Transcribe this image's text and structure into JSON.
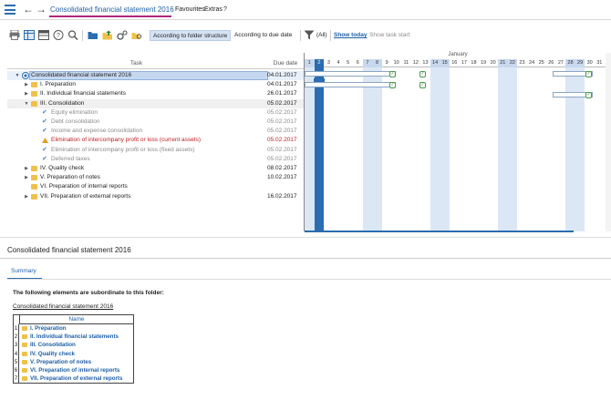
{
  "app": {
    "title": "Consolidated financial statement 2016",
    "menu": [
      "Favourites",
      "Extras",
      "?"
    ]
  },
  "toolbar": {
    "view_modes": [
      {
        "label": "According to folder structure",
        "active": true
      },
      {
        "label": "According to due date",
        "active": false
      }
    ],
    "filter_label": "(All)",
    "show_today_label": "Show today",
    "show_task_start_label": "Show task start"
  },
  "tree": {
    "col_task": "Task",
    "col_due": "Due date",
    "rows": [
      {
        "label": "Consolidated financial statement 2016",
        "due": "04.01.2017",
        "level": 0,
        "expand": "▼",
        "icon": "consolidation-root-icon",
        "style": "selected"
      },
      {
        "label": "I. Preparation",
        "due": "04.01.2017",
        "level": 1,
        "expand": "▶",
        "icon": "folder-icon",
        "style": "normal"
      },
      {
        "label": "II. Individual financial statements",
        "due": "26.01.2017",
        "level": 1,
        "expand": "▶",
        "icon": "folder-icon",
        "style": "normal"
      },
      {
        "label": "III. Consolidation",
        "due": "05.02.2017",
        "level": 1,
        "expand": "▼",
        "icon": "folder-icon",
        "style": "hover"
      },
      {
        "label": "Equity elimination",
        "due": "05.02.2017",
        "level": 2,
        "expand": "",
        "icon": "task-check-icon",
        "style": "done"
      },
      {
        "label": "Debt consolidation",
        "due": "05.02.2017",
        "level": 2,
        "expand": "",
        "icon": "task-check-icon",
        "style": "done"
      },
      {
        "label": "Income and expense consolidation",
        "due": "05.02.2017",
        "level": 2,
        "expand": "",
        "icon": "task-check-icon",
        "style": "done"
      },
      {
        "label": "Elimination of intercompany profit or loss (current assets)",
        "due": "05.02.2017",
        "level": 2,
        "expand": "",
        "icon": "warning-icon",
        "style": "warning"
      },
      {
        "label": "Elimination of intercompany profit or loss (fixed assets)",
        "due": "05.02.2017",
        "level": 2,
        "expand": "",
        "icon": "task-check-icon",
        "style": "done"
      },
      {
        "label": "Deferred taxes",
        "due": "05.02.2017",
        "level": 2,
        "expand": "",
        "icon": "task-check-icon",
        "style": "done"
      },
      {
        "label": "IV. Quality check",
        "due": "08.02.2017",
        "level": 1,
        "expand": "▶",
        "icon": "folder-icon",
        "style": "normal"
      },
      {
        "label": "V. Preparation of notes",
        "due": "10.02.2017",
        "level": 1,
        "expand": "▶",
        "icon": "folder-icon",
        "style": "normal"
      },
      {
        "label": "VI. Preparation of internal reports",
        "due": "",
        "level": 1,
        "expand": "",
        "icon": "folder-icon",
        "style": "normal"
      },
      {
        "label": "VII. Preparation of external reports",
        "due": "16.02.2017",
        "level": 1,
        "expand": "▶",
        "icon": "folder-icon",
        "style": "normal"
      }
    ]
  },
  "gantt": {
    "month": "January",
    "days": [
      "1",
      "2",
      "3",
      "4",
      "5",
      "6",
      "7",
      "8",
      "9",
      "10",
      "11",
      "12",
      "13",
      "14",
      "15",
      "16",
      "17",
      "18",
      "19",
      "20",
      "21",
      "22",
      "23",
      "24",
      "25",
      "26",
      "27",
      "28",
      "29",
      "30",
      "31"
    ],
    "today_day": "2",
    "weekend_days": [
      "1",
      "7",
      "8",
      "14",
      "15",
      "21",
      "22",
      "28",
      "29"
    ],
    "colors": {
      "accent": "#2a6db0",
      "weekend": "#dce7f5",
      "milestone": "#3a8a3a"
    }
  },
  "bottom": {
    "title": "Consolidated financial statement 2016",
    "tab_summary": "Summary",
    "intro": "The following elements are subordinate to this folder:",
    "folder_link": "Consolidated financial statement 2016",
    "table_header": "Name",
    "items": [
      {
        "num": "1",
        "name": "I. Preparation"
      },
      {
        "num": "2",
        "name": "II. Individual financial statements"
      },
      {
        "num": "3",
        "name": "III. Consolidation"
      },
      {
        "num": "4",
        "name": "IV. Quality check"
      },
      {
        "num": "5",
        "name": "V. Preparation of notes"
      },
      {
        "num": "6",
        "name": "VI. Preparation of internal reports"
      },
      {
        "num": "7",
        "name": "VII. Preparation of external reports"
      }
    ]
  }
}
